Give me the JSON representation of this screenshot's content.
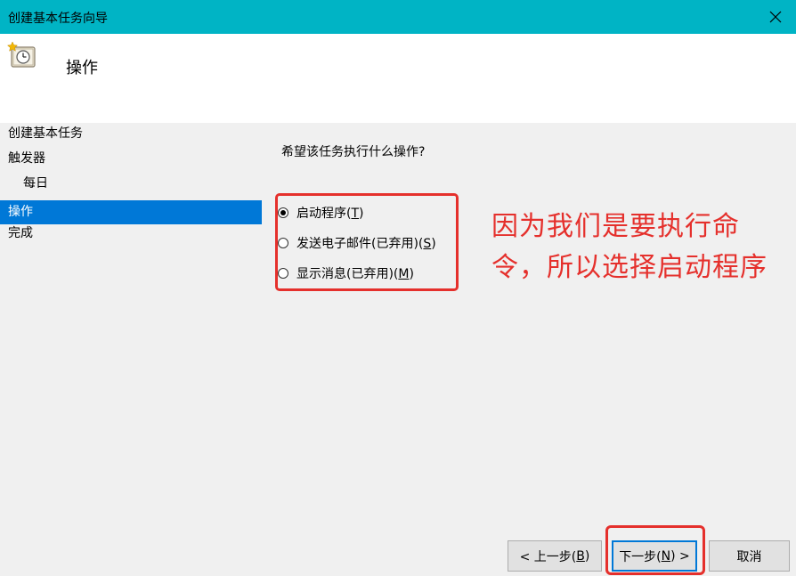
{
  "window": {
    "title": "创建基本任务向导"
  },
  "header": {
    "heading": "操作"
  },
  "steps": [
    {
      "label": "创建基本任务"
    },
    {
      "label": "触发器"
    },
    {
      "label": "每日"
    },
    {
      "label": "操作"
    },
    {
      "label": "完成"
    }
  ],
  "question": "希望该任务执行什么操作?",
  "options": [
    {
      "label": "启动程序(",
      "key": "T",
      "end": ")",
      "checked": true
    },
    {
      "label": "发送电子邮件(已弃用)(",
      "key": "S",
      "end": ")",
      "checked": false
    },
    {
      "label": "显示消息(已弃用)(",
      "key": "M",
      "end": ")",
      "checked": false
    }
  ],
  "annotation": "因为我们是要执行命令，所以选择启动程序",
  "buttons": {
    "back_pre": "< 上一步(",
    "back_key": "B",
    "back_post": ")",
    "next_pre": "下一步(",
    "next_key": "N",
    "next_post": ") >",
    "cancel": "取消"
  },
  "colors": {
    "titlebar": "#00b4c5",
    "selection": "#0078d7",
    "annotation": "#e5302c"
  }
}
